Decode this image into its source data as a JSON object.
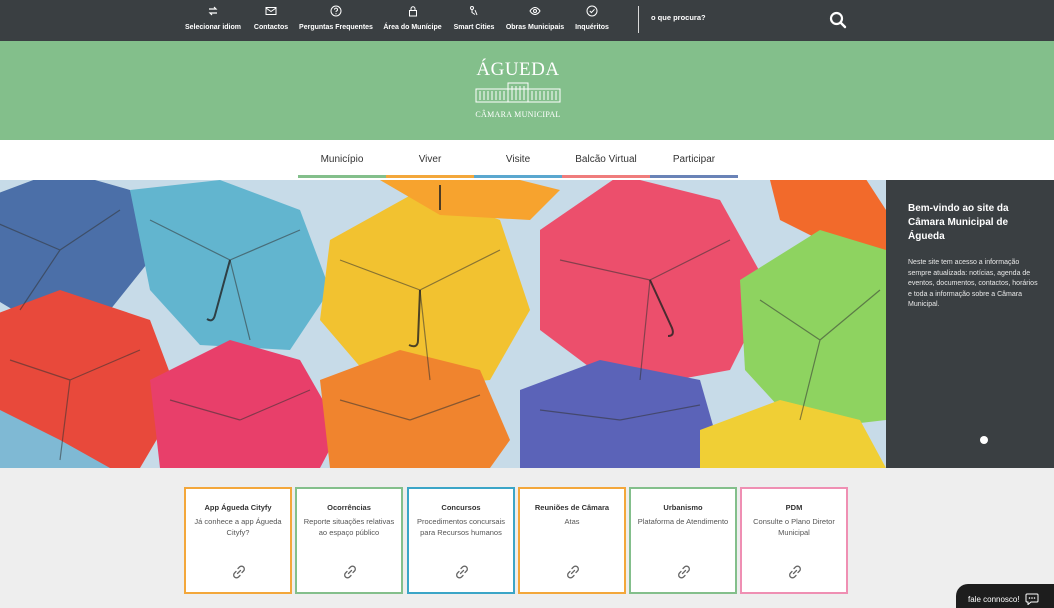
{
  "topbar": {
    "items": [
      {
        "label": "Selecionar idiom",
        "icon": "language-icon"
      },
      {
        "label": "Contactos",
        "icon": "mail-icon"
      },
      {
        "label": "Perguntas Frequentes",
        "icon": "question-icon"
      },
      {
        "label": "Área do Munícipe",
        "icon": "lock-icon"
      },
      {
        "label": "Smart Cities",
        "icon": "smart-cities-icon"
      },
      {
        "label": "Obras Municipais",
        "icon": "eye-icon"
      },
      {
        "label": "Inquéritos",
        "icon": "check-circle-icon"
      }
    ],
    "search_label": "o que procura?",
    "background": "#3a3f42"
  },
  "header": {
    "logo_main": "ÁGUEDA",
    "logo_sub": "CÂMARA MUNICIPAL",
    "background": "#83bf8b"
  },
  "nav": {
    "items": [
      {
        "label": "Município",
        "color": "#83bf8b"
      },
      {
        "label": "Viver",
        "color": "#f3a73b"
      },
      {
        "label": "Visite",
        "color": "#5aa7cf"
      },
      {
        "label": "Balcão Virtual",
        "color": "#ef7c7c"
      },
      {
        "label": "Participar",
        "color": "#6a83b7"
      }
    ]
  },
  "hero": {
    "title": "Bem-vindo ao site da Câmara Municipal de Águeda",
    "text": "Neste site tem acesso a informação sempre atualizada: notícias, agenda de eventos, documentos, contactos, horários e toda a informação sobre a Câmara Municipal."
  },
  "cards": [
    {
      "title": "App Águeda Cityfy",
      "desc": "Já conhece a app Águeda Cityfy?",
      "color": "#f3a73b"
    },
    {
      "title": "Ocorrências",
      "desc": "Reporte situações relativas ao espaço público",
      "color": "#83bf8b"
    },
    {
      "title": "Concursos",
      "desc": "Procedimentos concursais para Recursos humanos",
      "color": "#3ba5c7"
    },
    {
      "title": "Reuniões de Câmara",
      "desc": "Atas",
      "color": "#f3a73b"
    },
    {
      "title": "Urbanismo",
      "desc": "Plataforma de Atendimento",
      "color": "#83bf8b"
    },
    {
      "title": "PDM",
      "desc": "Consulte o Plano Diretor Municipal",
      "color": "#ef8fb3"
    }
  ],
  "chat": {
    "label": "fale connosco!"
  }
}
